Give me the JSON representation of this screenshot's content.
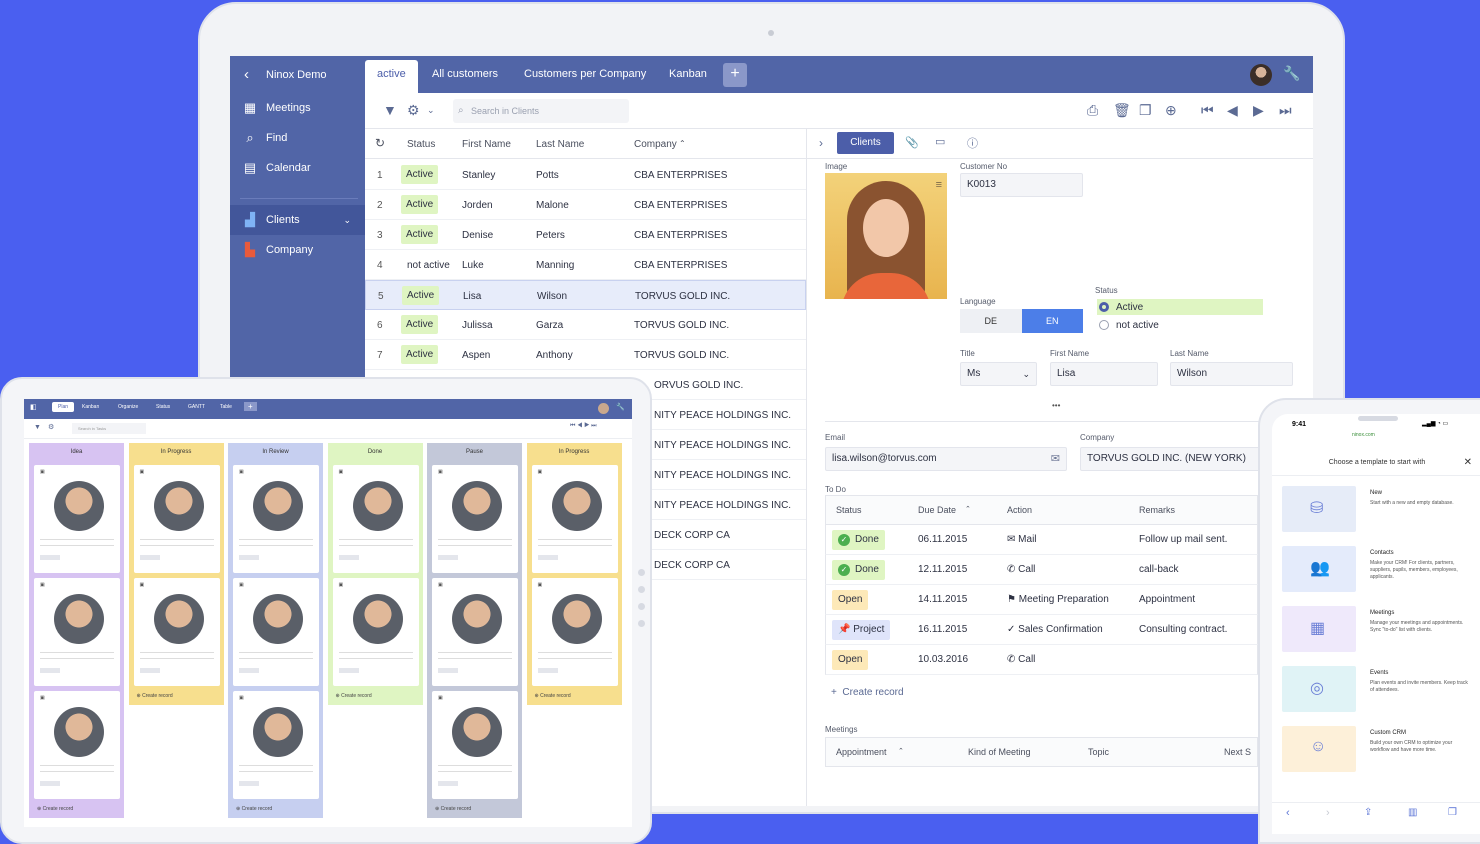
{
  "laptop": {
    "db_name": "Ninox Demo",
    "tabs": [
      "active",
      "All customers",
      "Customers per Company",
      "Kanban"
    ],
    "sidebar": [
      {
        "label": "Meetings",
        "icon": "grid-icon"
      },
      {
        "label": "Find",
        "icon": "search-icon"
      },
      {
        "label": "Calendar",
        "icon": "calendar-icon"
      },
      {
        "label": "Clients",
        "icon": "clients-icon"
      },
      {
        "label": "Company",
        "icon": "company-icon"
      }
    ],
    "search_placeholder": "Search in Clients",
    "columns": [
      "Status",
      "First Name",
      "Last Name",
      "Company"
    ],
    "rows": [
      {
        "num": "1",
        "status": "Active",
        "first": "Stanley",
        "last": "Potts",
        "company": "CBA ENTERPRISES"
      },
      {
        "num": "2",
        "status": "Active",
        "first": "Jorden",
        "last": "Malone",
        "company": "CBA ENTERPRISES"
      },
      {
        "num": "3",
        "status": "Active",
        "first": "Denise",
        "last": "Peters",
        "company": "CBA ENTERPRISES"
      },
      {
        "num": "4",
        "status": "not active",
        "first": "Luke",
        "last": "Manning",
        "company": "CBA ENTERPRISES"
      },
      {
        "num": "5",
        "status": "Active",
        "first": "Lisa",
        "last": "Wilson",
        "company": "TORVUS GOLD INC."
      },
      {
        "num": "6",
        "status": "Active",
        "first": "Julissa",
        "last": "Garza",
        "company": "TORVUS GOLD INC."
      },
      {
        "num": "7",
        "status": "Active",
        "first": "Aspen",
        "last": "Anthony",
        "company": "TORVUS GOLD INC."
      }
    ],
    "extra_companies": [
      "ORVUS GOLD INC.",
      "NITY PEACE HOLDINGS INC.",
      "NITY PEACE HOLDINGS INC.",
      "NITY PEACE HOLDINGS INC.",
      "NITY PEACE HOLDINGS INC.",
      "DECK CORP CA",
      "DECK CORP CA"
    ],
    "detail": {
      "tab": "Clients",
      "image_label": "Image",
      "customer_no_label": "Customer No",
      "customer_no": "K0013",
      "language_label": "Language",
      "lang_de": "DE",
      "lang_en": "EN",
      "status_label": "Status",
      "status_active": "Active",
      "status_inactive": "not active",
      "title_label": "Title",
      "title_value": "Ms",
      "first_label": "First Name",
      "first_value": "Lisa",
      "last_label": "Last Name",
      "last_value": "Wilson",
      "more": "•••",
      "email_label": "Email",
      "email_value": "lisa.wilson@torvus.com",
      "company_label": "Company",
      "company_value": "TORVUS GOLD INC. (NEW YORK)",
      "todo_label": "To Do",
      "todo_cols": [
        "Status",
        "Due Date",
        "Action",
        "Remarks"
      ],
      "todo_rows": [
        {
          "status": "Done",
          "due": "06.11.2015",
          "action": "Mail",
          "remarks": "Follow up mail sent."
        },
        {
          "status": "Done",
          "due": "12.11.2015",
          "action": "Call",
          "remarks": "call-back"
        },
        {
          "status": "Open",
          "due": "14.11.2015",
          "action": "Meeting Preparation",
          "remarks": "Appointment"
        },
        {
          "status": "Project",
          "due": "16.11.2015",
          "action": "Sales Confirmation",
          "remarks": "Consulting contract."
        },
        {
          "status": "Open",
          "due": "10.03.2016",
          "action": "Call",
          "remarks": ""
        }
      ],
      "create_record": "Create record",
      "meetings_label": "Meetings",
      "meeting_cols": [
        "Appointment",
        "Kind of Meeting",
        "Topic",
        "Next S"
      ]
    }
  },
  "tablet": {
    "tabs": [
      "Plan",
      "Kanban",
      "Organize",
      "Status",
      "GANTT",
      "Table"
    ],
    "search": "Search in Tasks",
    "columns": [
      {
        "title": "Idea",
        "color": "#d7c3f2"
      },
      {
        "title": "In Progress",
        "color": "#f7df8e"
      },
      {
        "title": "In Review",
        "color": "#c6cff0"
      },
      {
        "title": "Done",
        "color": "#dff5c2"
      },
      {
        "title": "Pause",
        "color": "#c3c8d9"
      },
      {
        "title": "In Progress",
        "color": "#f7df8e"
      }
    ],
    "create": "Create record"
  },
  "phone": {
    "time": "9:41",
    "url": "ninox.com",
    "title": "Choose a template to start with",
    "items": [
      {
        "title": "New",
        "desc": "Start with a new and empty database.",
        "color": "#e6ecf8"
      },
      {
        "title": "Contacts",
        "desc": "Make your CRM! For clients, partners, suppliers, pupils, members, employees, applicants.",
        "color": "#e4ebfb"
      },
      {
        "title": "Meetings",
        "desc": "Manage your meetings and appointments. Sync \"to-do\" list with clients.",
        "color": "#efe9fb"
      },
      {
        "title": "Events",
        "desc": "Plan events and invite members. Keep track of attendees.",
        "color": "#e0f3f6"
      },
      {
        "title": "Custom CRM",
        "desc": "Build your own CRM to optimize your workflow and have more time.",
        "color": "#fdf0d9"
      }
    ]
  }
}
